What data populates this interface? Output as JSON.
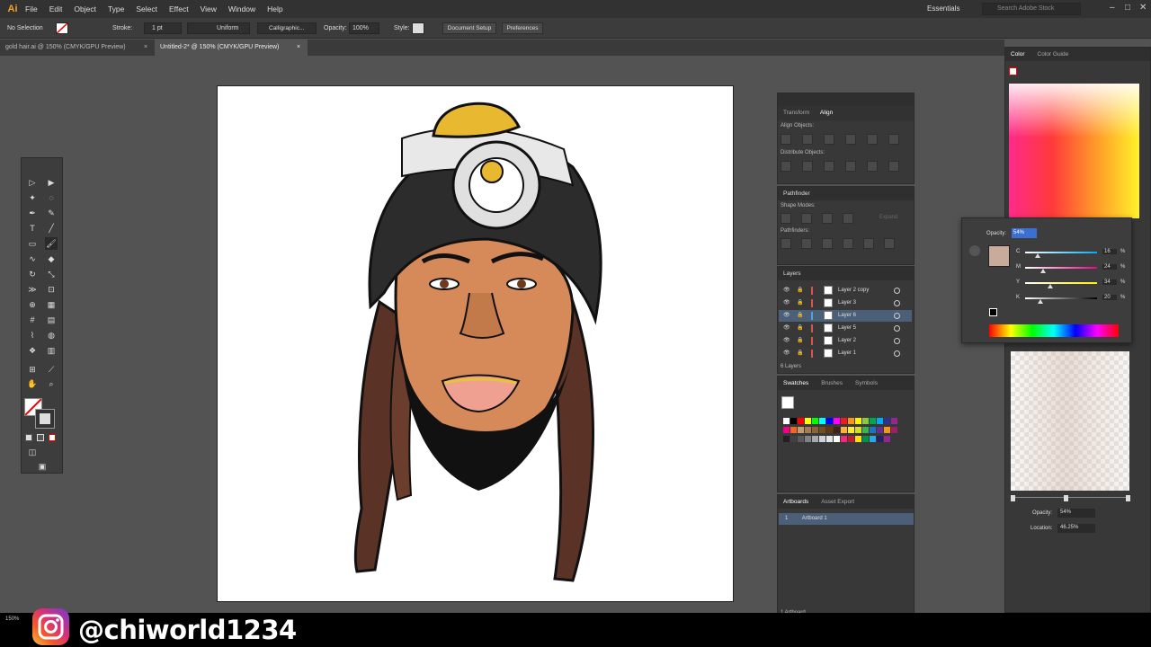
{
  "menubar": {
    "logo": "Ai",
    "items": [
      "File",
      "Edit",
      "Object",
      "Type",
      "Select",
      "Effect",
      "View",
      "Window",
      "Help"
    ],
    "workspace": "Essentials",
    "search_placeholder": "Search Adobe Stock"
  },
  "control_bar": {
    "selection": "No Selection",
    "stroke_label": "Stroke:",
    "stroke_value": "1 pt",
    "profile": "Uniform",
    "brush": "Calligraphic...",
    "opacity_label": "Opacity:",
    "opacity_value": "100%",
    "style_label": "Style:",
    "doc_setup": "Document Setup",
    "preferences": "Preferences"
  },
  "tabs": [
    {
      "label": "gold hair.ai @ 150% (CMYK/GPU Preview)",
      "active": false
    },
    {
      "label": "Untitled-2* @ 150% (CMYK/GPU Preview)",
      "active": true
    }
  ],
  "status": {
    "zoom": "150%"
  },
  "align_panel": {
    "tabs": [
      "Transform",
      "Align"
    ],
    "align_objects": "Align Objects:",
    "distribute_objects": "Distribute Objects:"
  },
  "pathfinder_panel": {
    "title": "Pathfinder",
    "shape_modes": "Shape Modes:",
    "expand": "Expand",
    "pathfinders": "Pathfinders:"
  },
  "layers_panel": {
    "title": "Layers",
    "layers": [
      {
        "name": "Layer 2 copy",
        "color": "#d9534f",
        "selected": false
      },
      {
        "name": "Layer 3",
        "color": "#d9534f",
        "selected": false
      },
      {
        "name": "Layer 6",
        "color": "#4fa3d9",
        "selected": true
      },
      {
        "name": "Layer 5",
        "color": "#d9534f",
        "selected": false
      },
      {
        "name": "Layer 2",
        "color": "#d9534f",
        "selected": false
      },
      {
        "name": "Layer 1",
        "color": "#d9534f",
        "selected": false
      }
    ],
    "count": "6 Layers"
  },
  "swatches_panel": {
    "tabs": [
      "Swatches",
      "Brushes",
      "Symbols"
    ],
    "colors": [
      "#ffffff",
      "#000000",
      "#ff0000",
      "#ffff00",
      "#00ff00",
      "#00ffff",
      "#0000ff",
      "#ff00ff",
      "#ed1c24",
      "#f7941d",
      "#fff200",
      "#8dc63f",
      "#00a651",
      "#00aeef",
      "#2e3192",
      "#92278f",
      "#ec008c",
      "#f26522",
      "#c69c6d",
      "#a67c52",
      "#8c6239",
      "#754c24",
      "#603913",
      "#3c2415",
      "#fbb040",
      "#f9ed32",
      "#d7df23",
      "#39b54a",
      "#1b75bc",
      "#662d91",
      "#f7941d",
      "#9e1f63",
      "#231f20",
      "#414042",
      "#58595b",
      "#808285",
      "#a7a9ac",
      "#d1d3d4",
      "#e6e7e8",
      "#ffffff",
      "#ee2a7b",
      "#be1e2d",
      "#ffde17",
      "#009444",
      "#27aae1",
      "#262262",
      "#93278f"
    ]
  },
  "artboards_panel": {
    "tabs": [
      "Artboards",
      "Asset Export"
    ],
    "items": [
      {
        "num": "1",
        "name": "Artboard 1"
      }
    ],
    "count": "1 Artboard"
  },
  "color_panel": {
    "tabs": [
      "Color",
      "Color Guide"
    ]
  },
  "gradient_popup": {
    "opacity_label": "Opacity:",
    "opacity_value": "54%",
    "swatch_color": "#c8ab9a",
    "channels": [
      {
        "label": "C",
        "value": "16",
        "unit": "%"
      },
      {
        "label": "M",
        "value": "24",
        "unit": "%"
      },
      {
        "label": "Y",
        "value": "34",
        "unit": "%"
      },
      {
        "label": "K",
        "value": "20",
        "unit": "%"
      }
    ]
  },
  "gradient_panel": {
    "opacity_label": "Opacity:",
    "opacity_value": "54%",
    "location_label": "Location:",
    "location_value": "46.25%"
  },
  "banner": {
    "handle": "@chiworld1234"
  }
}
